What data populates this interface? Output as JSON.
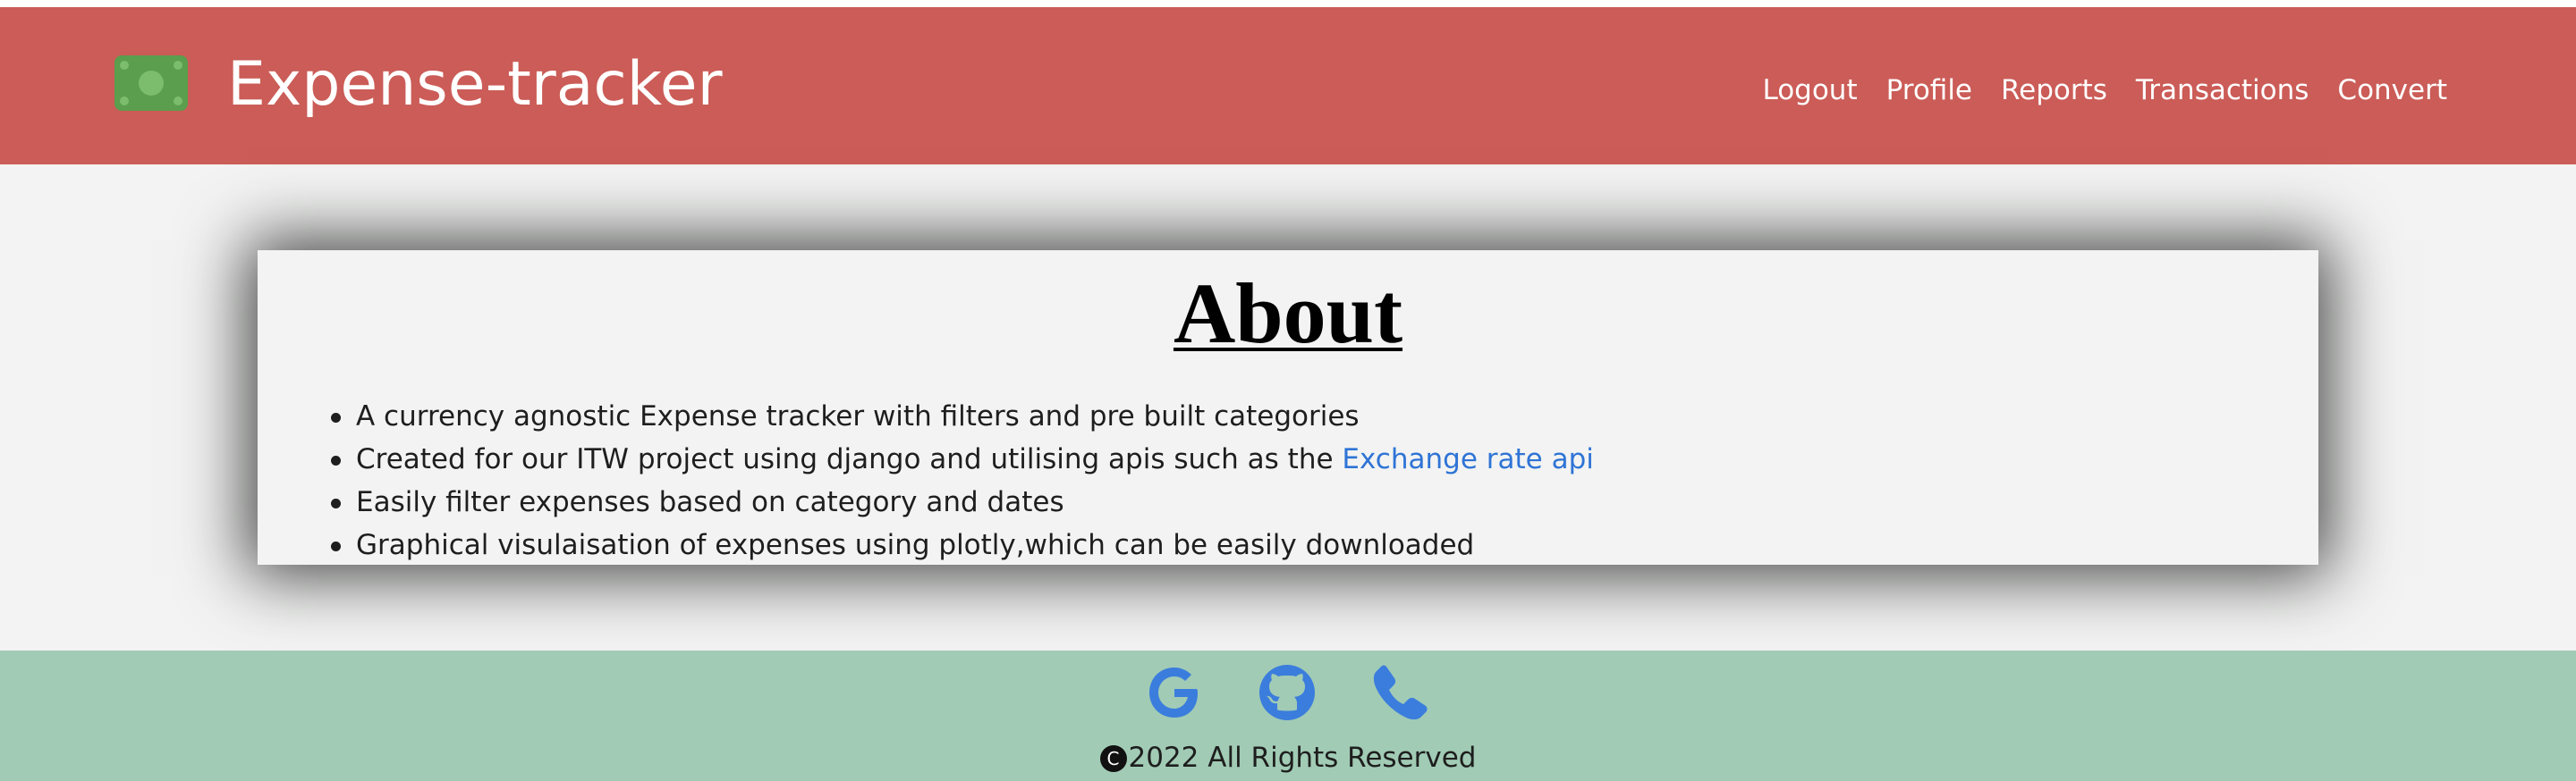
{
  "header": {
    "brand_title": "Expense-tracker",
    "brand_icon": "money-bill-icon",
    "nav": [
      {
        "label": "Logout"
      },
      {
        "label": "Profile"
      },
      {
        "label": "Reports"
      },
      {
        "label": "Transactions"
      },
      {
        "label": "Convert"
      }
    ]
  },
  "about": {
    "title": "About",
    "items": [
      {
        "text": "A currency agnostic Expense tracker with filters and pre built categories"
      },
      {
        "text": "Created for our ITW project using django and utilising apis such as the ",
        "link": "Exchange rate api"
      },
      {
        "text": "Easily filter expenses based on category and dates"
      },
      {
        "text": "Graphical visulaisation of expenses using plotly,which can be easily downloaded"
      }
    ]
  },
  "footer": {
    "icons": [
      "google-icon",
      "github-icon",
      "phone-icon"
    ],
    "copyright_symbol": "C",
    "copyright_text": "2022 All Rights Reserved"
  },
  "colors": {
    "navbar": "#cb5c57",
    "brand_icon": "#5a9e4e",
    "background": "#f2f3f2",
    "footer": "#a1cbb5",
    "link": "#2f74d6",
    "footer_icon": "#3b7ddd"
  }
}
